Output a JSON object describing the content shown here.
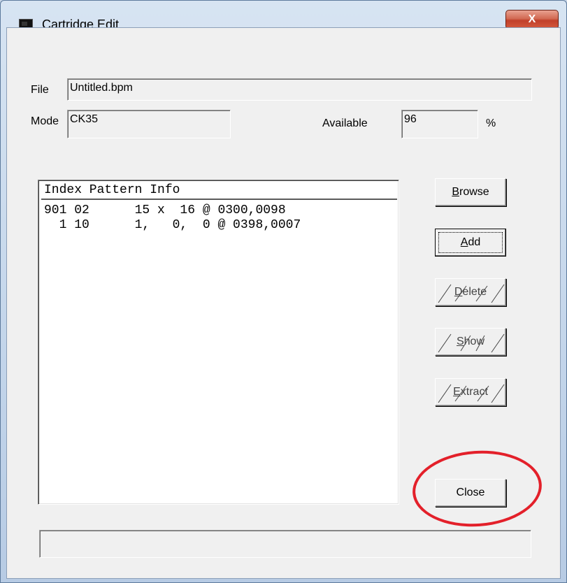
{
  "window": {
    "title": "Cartridge Edit",
    "close_glyph": "X",
    "app_icon": "app-window-icon"
  },
  "file": {
    "label": "File",
    "value": "Untitled.bpm"
  },
  "mode": {
    "label": "Mode",
    "value": "CK35"
  },
  "available": {
    "label": "Available",
    "value": "96",
    "unit": "%"
  },
  "list": {
    "header": "Index Pattern Info",
    "rows": [
      "901 02      15 x  16 @ 0300,0098",
      "  1 10      1,   0,  0 @ 0398,0007"
    ]
  },
  "buttons": {
    "browse": {
      "pre": "",
      "mnemonic": "B",
      "post": "rowse"
    },
    "add": {
      "pre": "",
      "mnemonic": "A",
      "post": "dd"
    },
    "delete": {
      "pre": "",
      "mnemonic": "D",
      "post": "elete"
    },
    "show": {
      "pre": "",
      "mnemonic": "S",
      "post": "how"
    },
    "extract": {
      "pre": "",
      "mnemonic": "E",
      "post": "xtract"
    },
    "close": {
      "label": "Close"
    }
  },
  "annotation_color": "#e3202a"
}
